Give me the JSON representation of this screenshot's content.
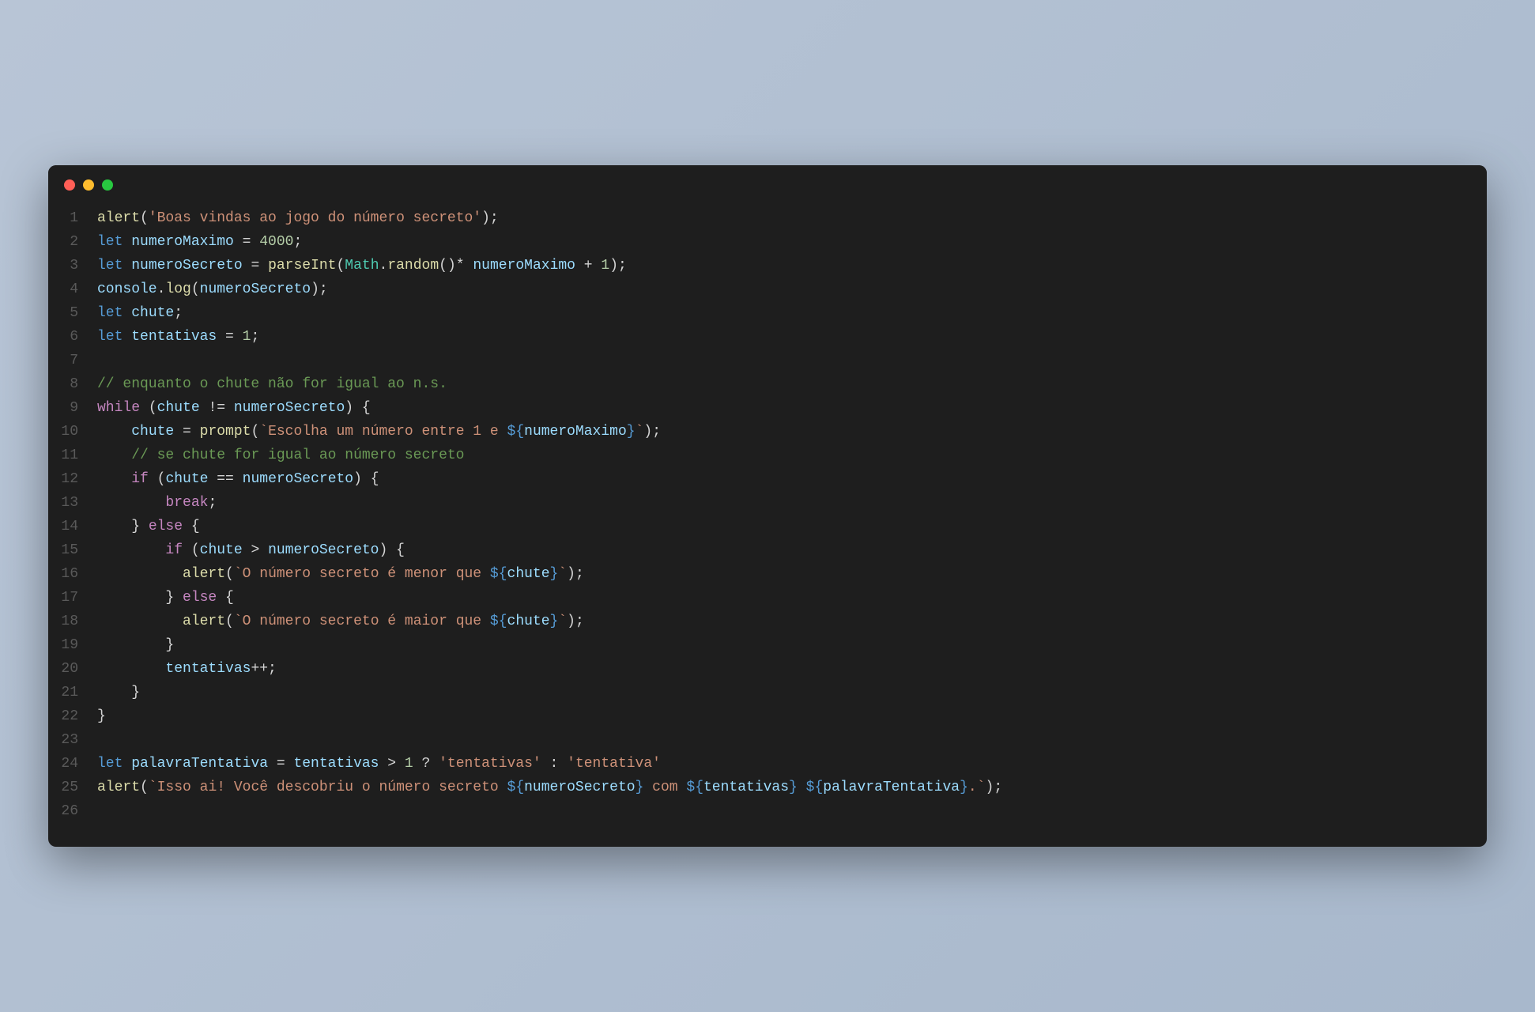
{
  "window": {
    "traffic_lights": [
      "close",
      "minimize",
      "zoom"
    ]
  },
  "code": {
    "lines": [
      {
        "num": "1",
        "tokens": [
          {
            "t": "alert",
            "c": "function"
          },
          {
            "t": "(",
            "c": "punctuation"
          },
          {
            "t": "'Boas vindas ao jogo do número secreto'",
            "c": "string"
          },
          {
            "t": ");",
            "c": "punctuation"
          }
        ]
      },
      {
        "num": "2",
        "tokens": [
          {
            "t": "let ",
            "c": "declare"
          },
          {
            "t": "numeroMaximo",
            "c": "variable"
          },
          {
            "t": " = ",
            "c": "operator"
          },
          {
            "t": "4000",
            "c": "number"
          },
          {
            "t": ";",
            "c": "punctuation"
          }
        ]
      },
      {
        "num": "3",
        "tokens": [
          {
            "t": "let ",
            "c": "declare"
          },
          {
            "t": "numeroSecreto",
            "c": "variable"
          },
          {
            "t": " = ",
            "c": "operator"
          },
          {
            "t": "parseInt",
            "c": "function"
          },
          {
            "t": "(",
            "c": "punctuation"
          },
          {
            "t": "Math",
            "c": "class-name"
          },
          {
            "t": ".",
            "c": "punctuation"
          },
          {
            "t": "random",
            "c": "function"
          },
          {
            "t": "()* ",
            "c": "punctuation"
          },
          {
            "t": "numeroMaximo",
            "c": "variable"
          },
          {
            "t": " + ",
            "c": "operator"
          },
          {
            "t": "1",
            "c": "number"
          },
          {
            "t": ");",
            "c": "punctuation"
          }
        ]
      },
      {
        "num": "4",
        "tokens": [
          {
            "t": "console",
            "c": "variable"
          },
          {
            "t": ".",
            "c": "punctuation"
          },
          {
            "t": "log",
            "c": "function"
          },
          {
            "t": "(",
            "c": "punctuation"
          },
          {
            "t": "numeroSecreto",
            "c": "variable"
          },
          {
            "t": ");",
            "c": "punctuation"
          }
        ]
      },
      {
        "num": "5",
        "tokens": [
          {
            "t": "let ",
            "c": "declare"
          },
          {
            "t": "chute",
            "c": "variable"
          },
          {
            "t": ";",
            "c": "punctuation"
          }
        ]
      },
      {
        "num": "6",
        "tokens": [
          {
            "t": "let ",
            "c": "declare"
          },
          {
            "t": "tentativas",
            "c": "variable"
          },
          {
            "t": " = ",
            "c": "operator"
          },
          {
            "t": "1",
            "c": "number"
          },
          {
            "t": ";",
            "c": "punctuation"
          }
        ]
      },
      {
        "num": "7",
        "tokens": []
      },
      {
        "num": "8",
        "tokens": [
          {
            "t": "// enquanto o chute não for igual ao n.s.",
            "c": "comment"
          }
        ]
      },
      {
        "num": "9",
        "tokens": [
          {
            "t": "while",
            "c": "keyword"
          },
          {
            "t": " (",
            "c": "punctuation"
          },
          {
            "t": "chute",
            "c": "variable"
          },
          {
            "t": " != ",
            "c": "operator"
          },
          {
            "t": "numeroSecreto",
            "c": "variable"
          },
          {
            "t": ") {",
            "c": "punctuation"
          }
        ]
      },
      {
        "num": "10",
        "tokens": [
          {
            "t": "    ",
            "c": ""
          },
          {
            "t": "chute",
            "c": "variable"
          },
          {
            "t": " = ",
            "c": "operator"
          },
          {
            "t": "prompt",
            "c": "function"
          },
          {
            "t": "(",
            "c": "punctuation"
          },
          {
            "t": "`Escolha um número entre 1 e ",
            "c": "string"
          },
          {
            "t": "${",
            "c": "template-expr"
          },
          {
            "t": "numeroMaximo",
            "c": "variable"
          },
          {
            "t": "}",
            "c": "template-expr"
          },
          {
            "t": "`",
            "c": "string"
          },
          {
            "t": ");",
            "c": "punctuation"
          }
        ]
      },
      {
        "num": "11",
        "tokens": [
          {
            "t": "    ",
            "c": ""
          },
          {
            "t": "// se chute for igual ao número secreto",
            "c": "comment"
          }
        ]
      },
      {
        "num": "12",
        "tokens": [
          {
            "t": "    ",
            "c": ""
          },
          {
            "t": "if",
            "c": "keyword"
          },
          {
            "t": " (",
            "c": "punctuation"
          },
          {
            "t": "chute",
            "c": "variable"
          },
          {
            "t": " == ",
            "c": "operator"
          },
          {
            "t": "numeroSecreto",
            "c": "variable"
          },
          {
            "t": ") {",
            "c": "punctuation"
          }
        ]
      },
      {
        "num": "13",
        "tokens": [
          {
            "t": "        ",
            "c": ""
          },
          {
            "t": "break",
            "c": "keyword"
          },
          {
            "t": ";",
            "c": "punctuation"
          }
        ]
      },
      {
        "num": "14",
        "tokens": [
          {
            "t": "    } ",
            "c": "punctuation"
          },
          {
            "t": "else",
            "c": "keyword"
          },
          {
            "t": " {",
            "c": "punctuation"
          }
        ]
      },
      {
        "num": "15",
        "tokens": [
          {
            "t": "        ",
            "c": ""
          },
          {
            "t": "if",
            "c": "keyword"
          },
          {
            "t": " (",
            "c": "punctuation"
          },
          {
            "t": "chute",
            "c": "variable"
          },
          {
            "t": " > ",
            "c": "operator"
          },
          {
            "t": "numeroSecreto",
            "c": "variable"
          },
          {
            "t": ") {",
            "c": "punctuation"
          }
        ]
      },
      {
        "num": "16",
        "tokens": [
          {
            "t": "          ",
            "c": ""
          },
          {
            "t": "alert",
            "c": "function"
          },
          {
            "t": "(",
            "c": "punctuation"
          },
          {
            "t": "`O número secreto é menor que ",
            "c": "string"
          },
          {
            "t": "${",
            "c": "template-expr"
          },
          {
            "t": "chute",
            "c": "variable"
          },
          {
            "t": "}",
            "c": "template-expr"
          },
          {
            "t": "`",
            "c": "string"
          },
          {
            "t": ");",
            "c": "punctuation"
          }
        ]
      },
      {
        "num": "17",
        "tokens": [
          {
            "t": "        } ",
            "c": "punctuation"
          },
          {
            "t": "else",
            "c": "keyword"
          },
          {
            "t": " {",
            "c": "punctuation"
          }
        ]
      },
      {
        "num": "18",
        "tokens": [
          {
            "t": "          ",
            "c": ""
          },
          {
            "t": "alert",
            "c": "function"
          },
          {
            "t": "(",
            "c": "punctuation"
          },
          {
            "t": "`O número secreto é maior que ",
            "c": "string"
          },
          {
            "t": "${",
            "c": "template-expr"
          },
          {
            "t": "chute",
            "c": "variable"
          },
          {
            "t": "}",
            "c": "template-expr"
          },
          {
            "t": "`",
            "c": "string"
          },
          {
            "t": ");",
            "c": "punctuation"
          }
        ]
      },
      {
        "num": "19",
        "tokens": [
          {
            "t": "        }",
            "c": "punctuation"
          }
        ]
      },
      {
        "num": "20",
        "tokens": [
          {
            "t": "        ",
            "c": ""
          },
          {
            "t": "tentativas",
            "c": "variable"
          },
          {
            "t": "++;",
            "c": "punctuation"
          }
        ]
      },
      {
        "num": "21",
        "tokens": [
          {
            "t": "    }",
            "c": "punctuation"
          }
        ]
      },
      {
        "num": "22",
        "tokens": [
          {
            "t": "}",
            "c": "punctuation"
          }
        ]
      },
      {
        "num": "23",
        "tokens": []
      },
      {
        "num": "24",
        "tokens": [
          {
            "t": "let ",
            "c": "declare"
          },
          {
            "t": "palavraTentativa",
            "c": "variable"
          },
          {
            "t": " = ",
            "c": "operator"
          },
          {
            "t": "tentativas",
            "c": "variable"
          },
          {
            "t": " > ",
            "c": "operator"
          },
          {
            "t": "1",
            "c": "number"
          },
          {
            "t": " ? ",
            "c": "operator"
          },
          {
            "t": "'tentativas'",
            "c": "string"
          },
          {
            "t": " : ",
            "c": "operator"
          },
          {
            "t": "'tentativa'",
            "c": "string"
          }
        ]
      },
      {
        "num": "25",
        "tokens": [
          {
            "t": "alert",
            "c": "function"
          },
          {
            "t": "(",
            "c": "punctuation"
          },
          {
            "t": "`Isso ai! Você descobriu o número secreto ",
            "c": "string"
          },
          {
            "t": "${",
            "c": "template-expr"
          },
          {
            "t": "numeroSecreto",
            "c": "variable"
          },
          {
            "t": "}",
            "c": "template-expr"
          },
          {
            "t": " com ",
            "c": "string"
          },
          {
            "t": "${",
            "c": "template-expr"
          },
          {
            "t": "tentativas",
            "c": "variable"
          },
          {
            "t": "}",
            "c": "template-expr"
          },
          {
            "t": " ",
            "c": "string"
          },
          {
            "t": "${",
            "c": "template-expr"
          },
          {
            "t": "palavraTentativa",
            "c": "variable"
          },
          {
            "t": "}",
            "c": "template-expr"
          },
          {
            "t": ".`",
            "c": "string"
          },
          {
            "t": ");",
            "c": "punctuation"
          }
        ]
      },
      {
        "num": "26",
        "tokens": []
      }
    ]
  }
}
